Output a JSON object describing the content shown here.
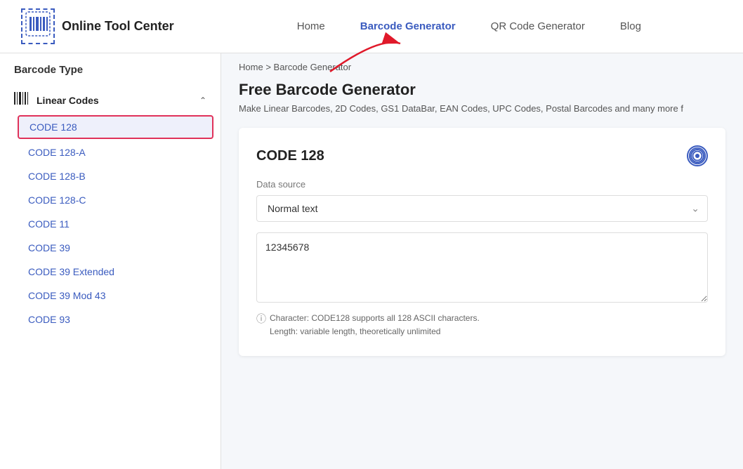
{
  "header": {
    "logo_icon": "▐║▌",
    "logo_text": "Online Tool Center",
    "nav": [
      {
        "label": "Home",
        "active": false
      },
      {
        "label": "Barcode Generator",
        "active": true
      },
      {
        "label": "QR Code Generator",
        "active": false
      },
      {
        "label": "Blog",
        "active": false
      }
    ]
  },
  "sidebar": {
    "title": "Barcode Type",
    "sections": [
      {
        "label": "Linear Codes",
        "expanded": true,
        "items": [
          {
            "label": "CODE 128",
            "selected": true
          },
          {
            "label": "CODE 128-A",
            "selected": false
          },
          {
            "label": "CODE 128-B",
            "selected": false
          },
          {
            "label": "CODE 128-C",
            "selected": false
          },
          {
            "label": "CODE 11",
            "selected": false
          },
          {
            "label": "CODE 39",
            "selected": false
          },
          {
            "label": "CODE 39 Extended",
            "selected": false
          },
          {
            "label": "CODE 39 Mod 43",
            "selected": false
          },
          {
            "label": "CODE 93",
            "selected": false
          }
        ]
      }
    ]
  },
  "breadcrumb": {
    "home": "Home",
    "separator": ">",
    "current": "Barcode Generator"
  },
  "main": {
    "title": "Free Barcode Generator",
    "subtitle": "Make Linear Barcodes, 2D Codes, GS1 DataBar, EAN Codes, UPC Codes, Postal Barcodes and many more f",
    "generator": {
      "title": "CODE 128",
      "data_source_label": "Data source",
      "select_value": "Normal text",
      "text_value": "12345678",
      "hint_line1": "Character: CODE128 supports all 128 ASCII characters.",
      "hint_line2": "Length: variable length, theoretically unlimited"
    }
  }
}
